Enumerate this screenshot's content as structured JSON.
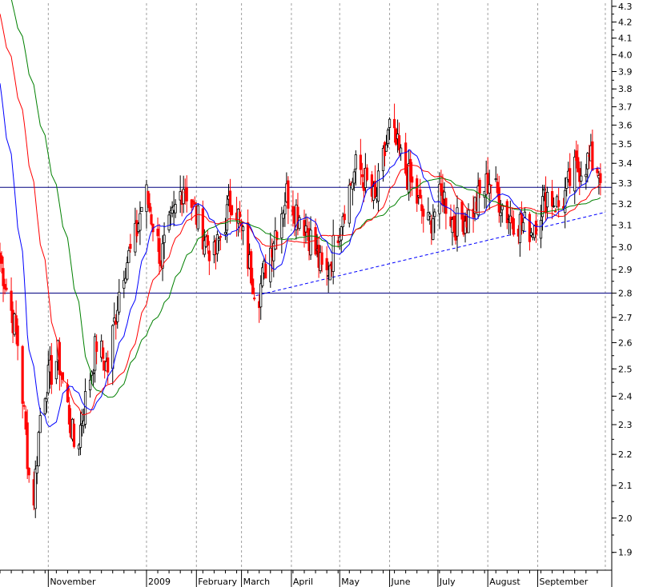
{
  "chart_data": {
    "type": "candlestick",
    "ylim": [
      1.85,
      4.32
    ],
    "y_scale": "log",
    "y_ticks": [
      "4.3",
      "4.2",
      "4.1",
      "4.0",
      "3.9",
      "3.8",
      "3.7",
      "3.6",
      "3.5",
      "3.4",
      "3.3",
      "3.2",
      "3.1",
      "3.0",
      "2.9",
      "2.8",
      "2.7",
      "2.6",
      "2.5",
      "2.4",
      "2.3",
      "2.2",
      "2.1",
      "2.0",
      "1.9"
    ],
    "x_labels": [
      {
        "label": "November",
        "day": 31
      },
      {
        "label": "2009",
        "day": 92
      },
      {
        "label": "February",
        "day": 123
      },
      {
        "label": "March",
        "day": 151
      },
      {
        "label": "April",
        "day": 182
      },
      {
        "label": "May",
        "day": 212
      },
      {
        "label": "June",
        "day": 243
      },
      {
        "label": "July",
        "day": 273
      },
      {
        "label": "August",
        "day": 304
      },
      {
        "label": "September",
        "day": 335
      }
    ],
    "x_range_days": [
      0,
      380
    ],
    "grid": {
      "vertical": "dashed",
      "horizontal": false
    },
    "horizontal_lines": [
      3.28,
      2.8
    ],
    "trendline": {
      "from": {
        "day": 159,
        "value": 2.79
      },
      "to": {
        "day": 376,
        "value": 3.16
      },
      "style": "dashed"
    },
    "up_color": "#000000",
    "down_color": "#ff0000",
    "ma_colors": {
      "fast": "#0000ff",
      "medium": "#ff0000",
      "slow": "#008000"
    },
    "key_points": [
      {
        "day": 0,
        "value": 2.95
      },
      {
        "day": 11,
        "value": 2.6
      },
      {
        "day": 20,
        "value": 2.0
      },
      {
        "day": 26,
        "value": 2.4
      },
      {
        "day": 36,
        "value": 2.55
      },
      {
        "day": 47,
        "value": 2.2
      },
      {
        "day": 60,
        "value": 2.6
      },
      {
        "day": 67,
        "value": 2.5
      },
      {
        "day": 76,
        "value": 2.9
      },
      {
        "day": 83,
        "value": 3.0
      },
      {
        "day": 90,
        "value": 3.27
      },
      {
        "day": 100,
        "value": 2.95
      },
      {
        "day": 114,
        "value": 3.3
      },
      {
        "day": 124,
        "value": 3.1
      },
      {
        "day": 133,
        "value": 2.95
      },
      {
        "day": 145,
        "value": 3.25
      },
      {
        "day": 152,
        "value": 3.0
      },
      {
        "day": 160,
        "value": 2.78
      },
      {
        "day": 170,
        "value": 3.05
      },
      {
        "day": 178,
        "value": 3.25
      },
      {
        "day": 190,
        "value": 3.1
      },
      {
        "day": 202,
        "value": 2.85
      },
      {
        "day": 214,
        "value": 3.2
      },
      {
        "day": 222,
        "value": 3.4
      },
      {
        "day": 233,
        "value": 3.2
      },
      {
        "day": 242,
        "value": 3.58
      },
      {
        "day": 250,
        "value": 3.4
      },
      {
        "day": 260,
        "value": 3.2
      },
      {
        "day": 266,
        "value": 3.1
      },
      {
        "day": 275,
        "value": 3.25
      },
      {
        "day": 282,
        "value": 3.1
      },
      {
        "day": 292,
        "value": 3.15
      },
      {
        "day": 304,
        "value": 3.32
      },
      {
        "day": 315,
        "value": 3.15
      },
      {
        "day": 330,
        "value": 3.08
      },
      {
        "day": 340,
        "value": 3.25
      },
      {
        "day": 348,
        "value": 3.18
      },
      {
        "day": 356,
        "value": 3.35
      },
      {
        "day": 366,
        "value": 3.42
      },
      {
        "day": 373,
        "value": 3.36
      }
    ]
  }
}
